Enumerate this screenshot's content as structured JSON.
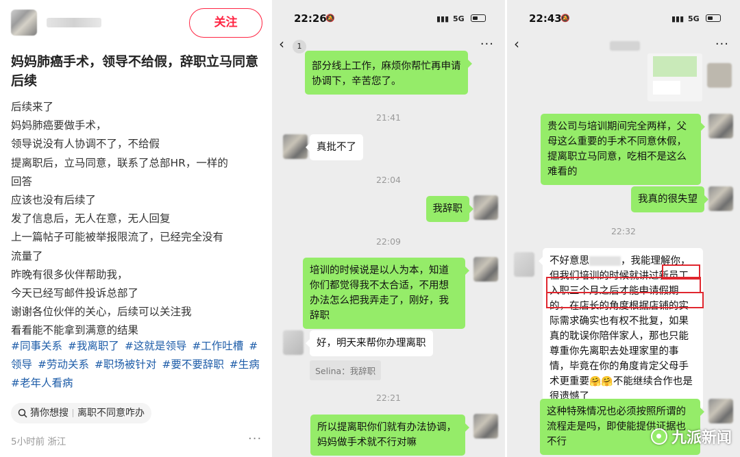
{
  "post": {
    "follow": "关注",
    "title": "妈妈肺癌手术，领导不给假，辞职立马同意后续",
    "body_lines": [
      "后续来了",
      "妈妈肺癌要做手术，",
      "领导说没有人协调不了，不给假",
      "提离职后，立马同意，联系了总部HR，一样的",
      "回答",
      "应该也没有后续了",
      "发了信息后，无人在意，无人回复",
      "上一篇帖子可能被举报限流了，已经完全没有",
      "流量了",
      "昨晚有很多伙伴帮助我，",
      "今天已经写邮件投诉总部了",
      "谢谢各位伙伴的关心，后续可以关注我",
      "看看能不能拿到满意的结果"
    ],
    "tags": [
      "#同事关系",
      "#我离职了",
      "#这就是领导",
      "#工作吐槽",
      "#领导",
      "#劳动关系",
      "#职场被针对",
      "#要不要辞职",
      "#生病",
      "#老年人看病"
    ],
    "search_prefix": "猜你想搜",
    "search_term": "离职不同意咋办",
    "meta": "5小时前  浙江",
    "more": "···"
  },
  "chat1": {
    "time": "22:26",
    "net": "5G",
    "badge": "1",
    "menu": "···",
    "m_top": "部分线上工作，麻烦你帮忙再申请协调下，辛苦您了。",
    "ts1": "21:41",
    "m1": "真批不了",
    "ts2": "22:04",
    "m2": "我辞职",
    "ts3": "22:09",
    "m3": "培训的时候说是以人为本，知道你们都觉得我不太合适，不用想办法怎么把我弄走了，刚好，我辞职",
    "m4": "好，明天来帮你办理离职",
    "quote": "Selina：我辞职",
    "ts4": "22:21",
    "m5": "所以提离职你们就有办法协调，妈妈做手术就不行对嘛"
  },
  "chat2": {
    "time": "22:43",
    "net": "5G",
    "menu": "···",
    "m1": "贵公司与培训期间完全两样，父母这么重要的手术不同意休假，提离职立马同意，吃相不是这么难看的",
    "m2": "我真的很失望",
    "ts1": "22:32",
    "m3_a": "不好意思",
    "m3_b": "，我能理解你，但我们培训的时候就讲过新员工入职三个月之后才能申请假期的，在店长的角度根据店铺的实际需求确实也有权不批复，如果真的耽误你陪伴家人，那也只能尊重你先离职去处理家里的事情，毕竟在你的角度肯定父母手术更重要",
    "m3_emoji": "🤗🤗",
    "m3_c": "不能继续合作也是很遗憾了",
    "m4": "这种特殊情况也必须按照所谓的流程走是吗，即使能提供证据也不行"
  },
  "watermark": "九派新闻"
}
